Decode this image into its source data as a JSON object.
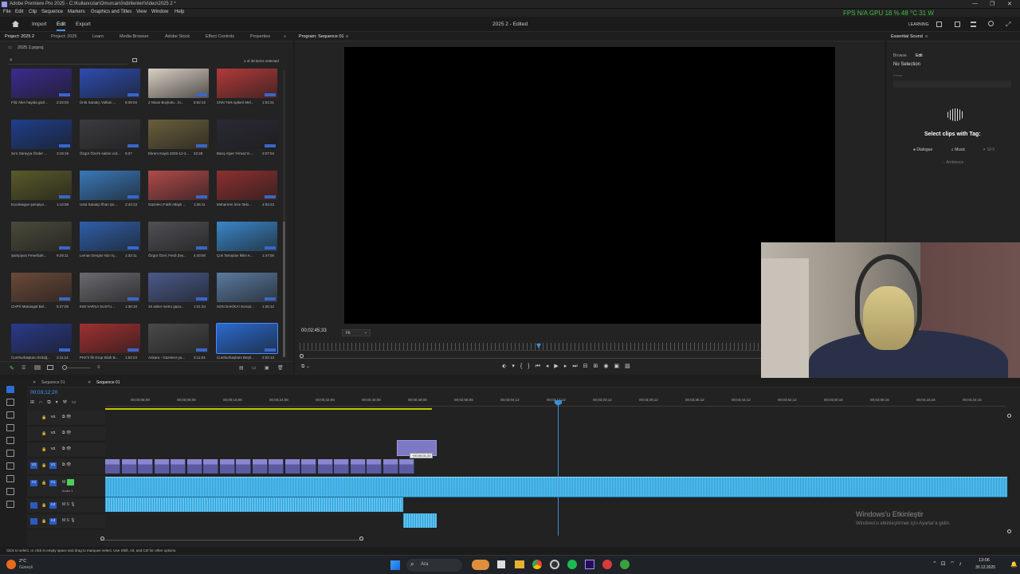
{
  "window": {
    "title": "Adobe Premiere Pro 2025 - C:\\Kullanıcılar\\Omurcan\\İndirilenler\\Video\\2025 2 *",
    "overlay_stats": "FPS N/A    GPU 18 % 48 °C 31 W",
    "controls": [
      "—",
      "❐",
      "✕"
    ]
  },
  "menu": [
    "File",
    "Edit",
    "Clip",
    "Sequence",
    "Markers",
    "Graphics and Titles",
    "View",
    "Window",
    "Help"
  ],
  "workspace": {
    "tabs": [
      "Import",
      "Edit",
      "Export"
    ],
    "active_tab": "Edit",
    "center_title": "2025 2 - Edited",
    "right_label": "LEARNING"
  },
  "project_panel": {
    "tabs": [
      "Project: 2025 2",
      "Project: 2025",
      "Learn",
      "Media Browser",
      "Adobe Stock",
      "Effect Controls",
      "Properties"
    ],
    "path": "2025 2.prproj",
    "selection_info": "1 of 48 items selected",
    "search_placeholder": "",
    "clips": [
      {
        "name": "Filiz Akın hayata gözl...",
        "duration": "2:23:03",
        "color": "#3b2c8f"
      },
      {
        "name": "Ünlü Sanatçı Volkan ...",
        "duration": "8:39:04",
        "color": "#2d4db0"
      },
      {
        "name": "2 Nisan Boykotu…lö...",
        "duration": "5:52:12",
        "color": "#d9cfc3"
      },
      {
        "name": "CNN Türk spikeri Mel...",
        "duration": "1:02:21",
        "color": "#b23a3a"
      },
      {
        "name": "Sırrı Süreyya Önder ...",
        "duration": "3:19:19",
        "color": "#1f3f8a"
      },
      {
        "name": "Özgür Özel'e saldırı ord...",
        "duration": "5:37",
        "color": "#3c3c40"
      },
      {
        "name": "Ekrem Kaydı 2025-12-2...",
        "duration": "22:28",
        "color": "#6a5f3c"
      },
      {
        "name": "Barış Alper Yılmaz'ın ...",
        "duration": "3:07:04",
        "color": "#2a2a35"
      },
      {
        "name": "Euroleague şampiyo...",
        "duration": "1:13:08",
        "color": "#5a5a2a"
      },
      {
        "name": "Usta Sanatçı İlhan Şe...",
        "duration": "2:43:13",
        "color": "#3a78b8"
      },
      {
        "name": "Gazeteci Fatih Altaylı ...",
        "duration": "1:36:11",
        "color": "#b04a4a"
      },
      {
        "name": "Muharrem İnce 'Bıkı...",
        "duration": "4:03:23",
        "color": "#8c3030"
      },
      {
        "name": "Şampiyon Fenerbah...",
        "duration": "9:29:11",
        "color": "#4a4a3a"
      },
      {
        "name": "Leman Dergisi Yazı İş...",
        "duration": "1:32:11",
        "color": "#2f5fa8"
      },
      {
        "name": "Özgür Özel, Ferdi Zey...",
        "duration": "4:40:00",
        "color": "#505055"
      },
      {
        "name": "Çok Tartışılan İklim K...",
        "duration": "1:47:00",
        "color": "#3a86c8"
      },
      {
        "name": "CHP'li Manavgat Bel...",
        "duration": "5:27:05",
        "color": "#6b4a3a"
      },
      {
        "name": "KIM VARSA SUSTU...",
        "duration": "1:38:19",
        "color": "#6a6a70"
      },
      {
        "name": "19 asker metro gaza...",
        "duration": "1:31:34",
        "color": "#4a5a8a"
      },
      {
        "name": "SON DAKİKA! Soruşt...",
        "duration": "1:26:12",
        "color": "#5a7aa0"
      },
      {
        "name": "Cumhurbaşkanı Erdoğ...",
        "duration": "3:11:14",
        "color": "#2a3a8a"
      },
      {
        "name": "PKK'lı İlk Grup Silah B...",
        "duration": "1:52:23",
        "color": "#a03030"
      },
      {
        "name": "Ankara - Gazeteci-ya...",
        "duration": "3:11:04",
        "color": "#4a4a4a"
      },
      {
        "name": "Cumhurbaşkanı Beşti...",
        "duration": "2:02:13",
        "color": "#2a6ad0"
      }
    ]
  },
  "program_monitor": {
    "tab": "Program: Sequence 01",
    "timecode": "00;02;45;33",
    "fit": "Fit"
  },
  "essential_sound": {
    "tab": "Essential Sound",
    "subtabs": [
      "Browse",
      "Edit"
    ],
    "status": "No Selection",
    "preset_label": "Preset",
    "prompt": "Select clips with Tag:",
    "tags": [
      "Dialogue",
      "Music",
      "SFX",
      "Ambience"
    ]
  },
  "timeline": {
    "tabs": [
      "Sequence 01",
      "Sequence 01"
    ],
    "timecode": "00;03;12;20",
    "ruler": [
      "00;00;08;08",
      "00;00;08;08",
      "00;00;16;08",
      "00;00;24;08",
      "00;00;32;08",
      "00;00;40;08",
      "00;00;48;08",
      "00;02;56;08",
      "00;03;04;12",
      "00;03;12;12",
      "00;03;20;12",
      "00;03;28;12",
      "00;03;36;12",
      "00;03;44;12",
      "00;03;52;12",
      "00;04;00;16",
      "00;04;08;16",
      "00;04;16;16",
      "00;04;24;16"
    ],
    "tracks": [
      "V4",
      "V3",
      "V2",
      "V1",
      "A1",
      "A2",
      "A3"
    ],
    "audio_label": "Audio 1",
    "drag_tooltip": "+00;00;01;23"
  },
  "watermark": {
    "line1": "Windows'u Etkinleştir",
    "line2": "Windows'u etkinleştirmek için Ayarlar'a gidin."
  },
  "status_bar": "Click to select, or click in empty space and drag to marquee select. Use Shift, Alt, and Ctrl for other options.",
  "taskbar": {
    "weather_temp": "2°C",
    "weather_desc": "Güneşli",
    "search": "Ara",
    "time": "13:06",
    "date": "30.12.2025"
  }
}
